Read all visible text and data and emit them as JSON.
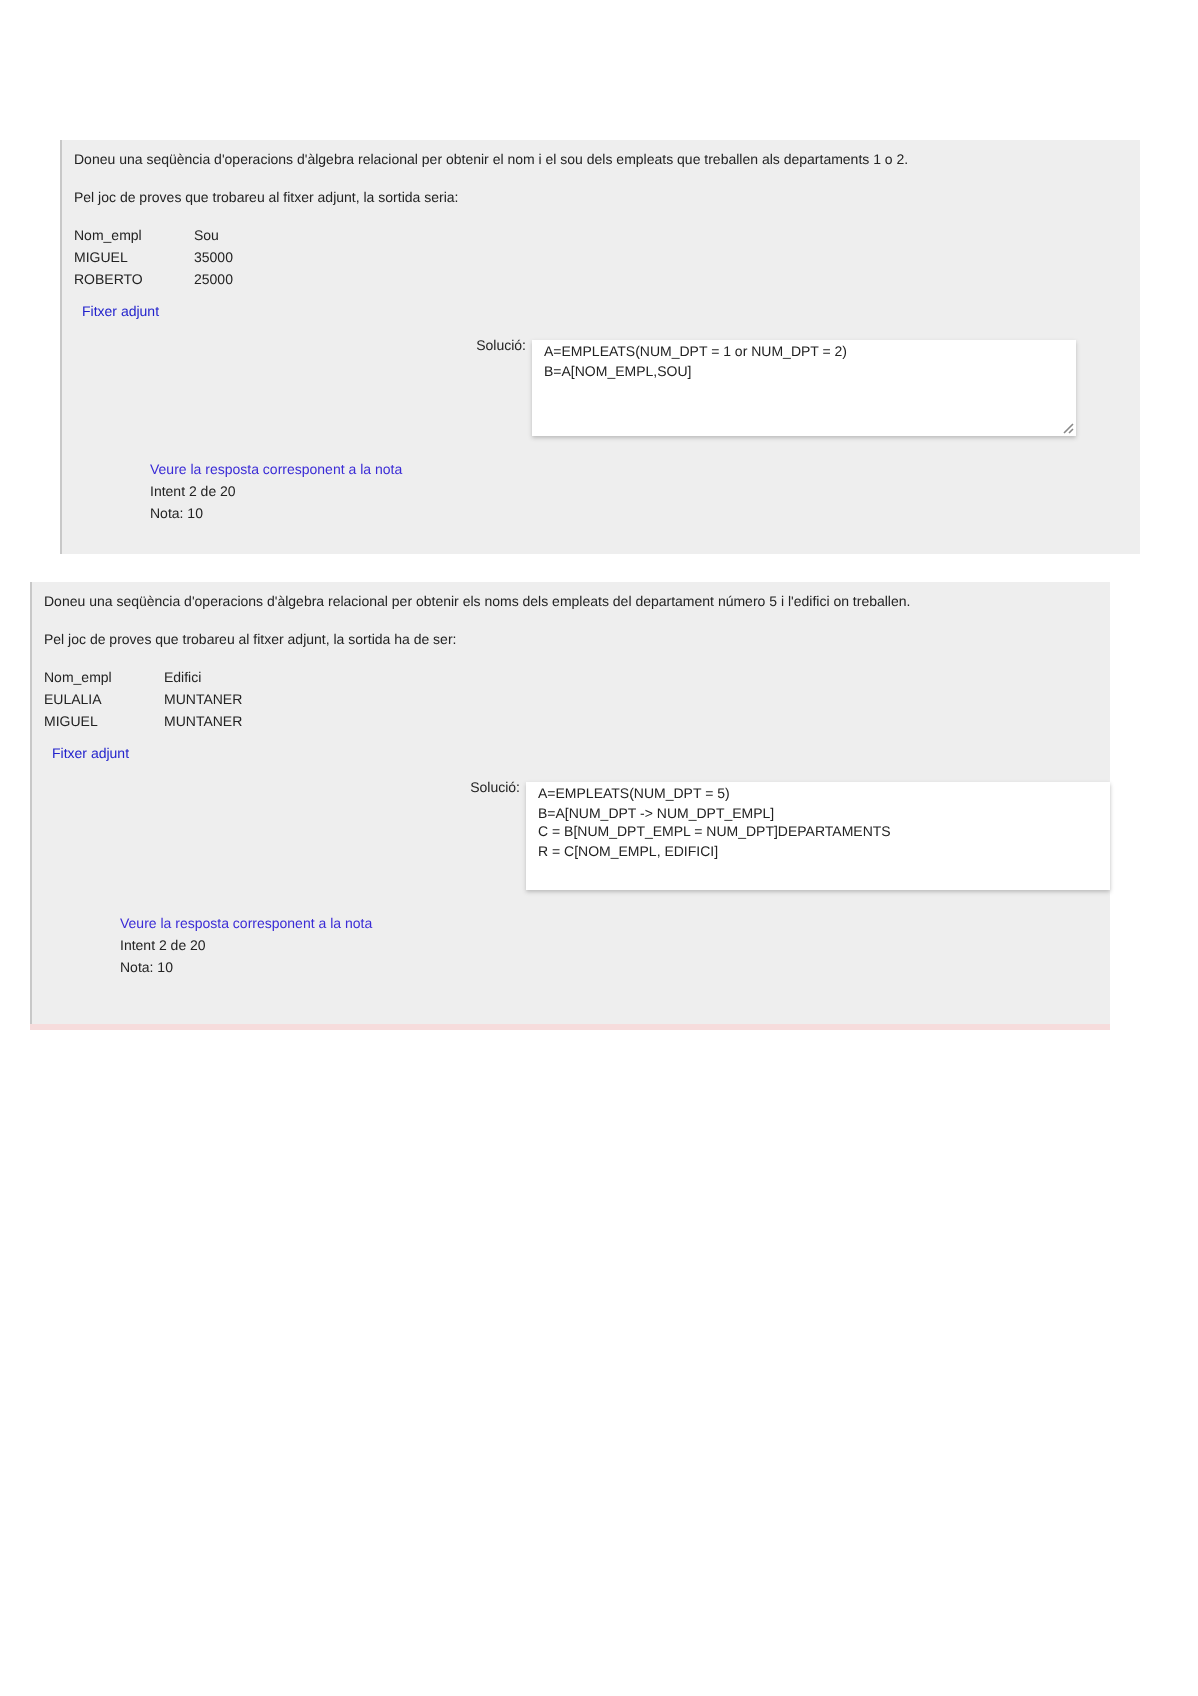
{
  "questions": [
    {
      "statement": "Doneu una seqüència d'operacions d'àlgebra relacional per obtenir el nom i el sou dels empleats que treballen als departaments 1 o 2.",
      "test_note": "Pel joc de proves que trobareu al fitxer adjunt, la sortida seria:",
      "table": {
        "columns": [
          "Nom_empl",
          "Sou"
        ],
        "rows": [
          [
            "MIGUEL",
            "35000"
          ],
          [
            "ROBERTO",
            "25000"
          ]
        ]
      },
      "attachment": "Fitxer adjunt",
      "answer_label": "Solució:",
      "answer_lines": [
        "A=EMPLEATS(NUM_DPT = 1 or NUM_DPT = 2)",
        "B=A[NOM_EMPL,SOU]"
      ],
      "resizable": true,
      "review_link": "Veure la resposta corresponent a la nota",
      "attempt": "Intent 2 de 20",
      "grade": "Nota: 10"
    },
    {
      "statement": "Doneu una seqüència d'operacions d'àlgebra relacional per obtenir els noms dels empleats del departament número 5 i l'edifici on treballen.",
      "test_note": "Pel joc de proves que trobareu al fitxer adjunt, la sortida ha de ser:",
      "table": {
        "columns": [
          "Nom_empl",
          "Edifici"
        ],
        "rows": [
          [
            "EULALIA",
            "MUNTANER"
          ],
          [
            "MIGUEL",
            "MUNTANER"
          ]
        ]
      },
      "attachment": "Fitxer adjunt",
      "answer_label": "Solució:",
      "answer_lines": [
        "A=EMPLEATS(NUM_DPT = 5)",
        "B=A[NUM_DPT -> NUM_DPT_EMPL]",
        "C = B[NUM_DPT_EMPL = NUM_DPT]DEPARTAMENTS",
        "R = C[NOM_EMPL, EDIFICI]"
      ],
      "resizable": false,
      "review_link": "Veure la resposta corresponent a la nota",
      "attempt": "Intent 2 de 20",
      "grade": "Nota: 10"
    }
  ]
}
